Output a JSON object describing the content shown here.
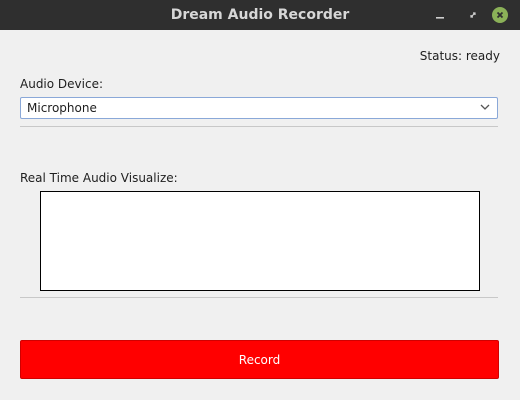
{
  "window": {
    "title": "Dream Audio Recorder",
    "minimize_icon": "minimize-icon",
    "maximize_icon": "restore-icon",
    "close_icon": "close-icon",
    "close_color": "#8bb158"
  },
  "status": {
    "text": "Status: ready"
  },
  "device": {
    "label": "Audio Device:",
    "selected": "Microphone",
    "chevron_icon": "chevron-down-icon"
  },
  "visualizer": {
    "label": "Real Time Audio Visualize:"
  },
  "record": {
    "label": "Record",
    "color": "#ff0000"
  }
}
